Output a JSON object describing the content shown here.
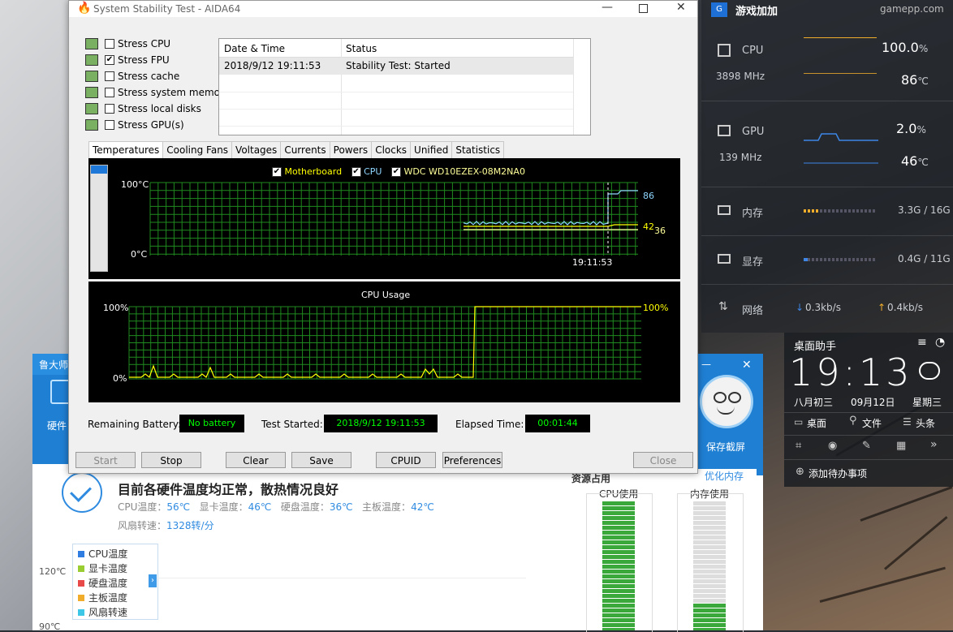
{
  "aida": {
    "title": "System Stability Test - AIDA64",
    "stress_items": [
      {
        "label": "Stress CPU",
        "checked": false
      },
      {
        "label": "Stress FPU",
        "checked": true
      },
      {
        "label": "Stress cache",
        "checked": false
      },
      {
        "label": "Stress system memory",
        "checked": false
      },
      {
        "label": "Stress local disks",
        "checked": false
      },
      {
        "label": "Stress GPU(s)",
        "checked": false
      }
    ],
    "log": {
      "headers": [
        "Date & Time",
        "Status"
      ],
      "rows": [
        [
          "2018/9/12 19:11:53",
          "Stability Test: Started"
        ]
      ]
    },
    "tabs": [
      "Temperatures",
      "Cooling Fans",
      "Voltages",
      "Currents",
      "Powers",
      "Clocks",
      "Unified",
      "Statistics"
    ],
    "temp_graph": {
      "legend": [
        "Motherboard",
        "CPU",
        "WDC WD10EZEX-08M2NA0"
      ],
      "y_top": "100°C",
      "y_bottom": "0°C",
      "time": "19:11:53",
      "values": [
        "86",
        "42",
        "36"
      ]
    },
    "cpu_graph": {
      "title": "CPU Usage",
      "y_top": "100%",
      "y_bottom": "0%",
      "value": "100%"
    },
    "status": {
      "battery_label": "Remaining Battery:",
      "battery_value": "No battery",
      "started_label": "Test Started:",
      "started_value": "2018/9/12 19:11:53",
      "elapsed_label": "Elapsed Time:",
      "elapsed_value": "00:01:44"
    },
    "buttons": [
      "Start",
      "Stop",
      "Clear",
      "Save",
      "CPUID",
      "Preferences",
      "Close"
    ]
  },
  "gamepp": {
    "brand": "游戏加加",
    "site": "gamepp.com",
    "cpu": {
      "label": "CPU",
      "freq": "3898 MHz",
      "usage": "100.0",
      "temp": "86"
    },
    "gpu": {
      "label": "GPU",
      "freq": "139 MHz",
      "usage": "2.0",
      "temp": "46"
    },
    "mem": {
      "label": "内存",
      "value": "3.3G / 16G"
    },
    "vram": {
      "label": "显存",
      "value": "0.4G / 11G"
    },
    "net": {
      "label": "网络",
      "down": "0.3kb/s",
      "up": "0.4kb/s"
    },
    "percent_unit": "%",
    "temp_unit": "℃"
  },
  "assistant": {
    "title": "桌面助手",
    "time": "19:13",
    "lunar": "八月初三",
    "date": "09月12日",
    "weekday": "星期三",
    "links": [
      "桌面",
      "文件",
      "头条"
    ],
    "todo": "添加待办事项"
  },
  "ludashi": {
    "title": "鲁大师",
    "side_label": "硬件",
    "headline": "目前各硬件温度均正常，散热情况良好",
    "temps": [
      {
        "label": "CPU温度：",
        "value": "56℃"
      },
      {
        "label": "显卡温度：",
        "value": "46℃"
      },
      {
        "label": "硬盘温度：",
        "value": "36℃"
      },
      {
        "label": "主板温度：",
        "value": "42℃"
      }
    ],
    "fan_label": "风扇转速：",
    "fan_value": "1328转/分",
    "legend": [
      "CPU温度",
      "显卡温度",
      "硬盘温度",
      "主板温度",
      "风扇转速"
    ],
    "legend_colors": [
      "#2f7de1",
      "#9acd32",
      "#e84a4a",
      "#f0ad2c",
      "#3cc7e6"
    ],
    "y_labels": [
      "120℃",
      "90℃"
    ],
    "save_shot": "保存截屏",
    "optimize": "优化内存",
    "resource_label": "资源占用",
    "cpu_use": "CPU使用",
    "mem_use": "内存使用"
  }
}
